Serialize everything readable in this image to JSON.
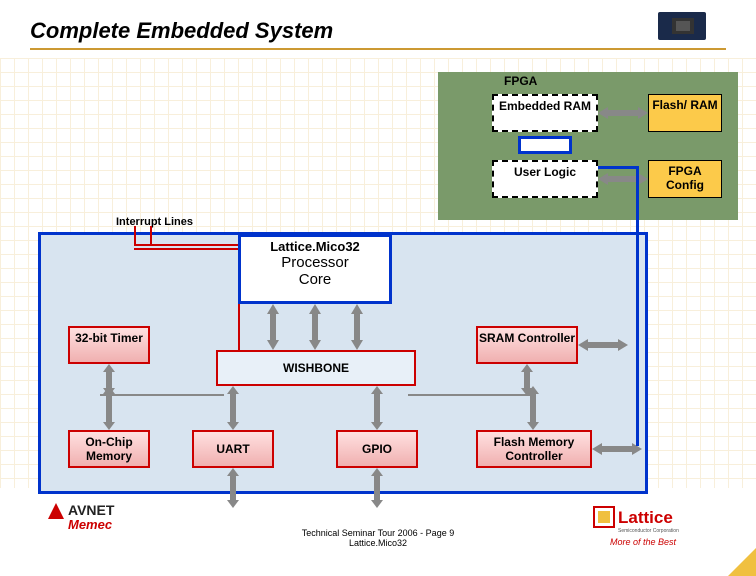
{
  "title": "Complete Embedded System",
  "fpga": {
    "label": "FPGA",
    "embedded_ram": "Embedded RAM",
    "user_logic": "User Logic",
    "flash_ram": "Flash/ RAM",
    "fpga_config": "FPGA Config"
  },
  "system": {
    "interrupt_label": "Interrupt Lines",
    "processor_l1": "Lattice.Mico32",
    "processor_l2": "Processor",
    "processor_l3": "Core",
    "timer": "32-bit Timer",
    "wishbone": "WISHBONE",
    "sram": "SRAM Controller",
    "onchip": "On-Chip Memory",
    "uart": "UART",
    "gpio": "GPIO",
    "flashmem": "Flash Memory Controller"
  },
  "footer": {
    "line1": "Technical Seminar Tour 2006 - Page 9",
    "line2": "Lattice.Mico32"
  },
  "logos": {
    "avnet": "AVNET",
    "memec": "Memec",
    "lattice": "Lattice",
    "lattice_sub": "Semiconductor Corporation",
    "tagline": "More of the Best"
  }
}
